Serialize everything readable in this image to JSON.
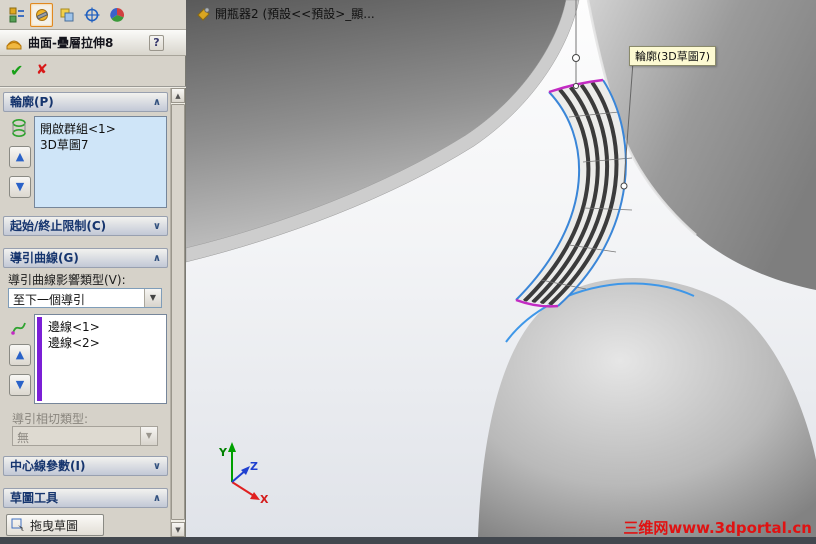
{
  "icons": {
    "help": "?",
    "ok": "✔",
    "cancel": "✘",
    "up_arrow": "▲",
    "down_arrow": "▼",
    "expanded": "∧",
    "collapsed": "∨",
    "combo_arrow": "▼",
    "scroll_up": "▲",
    "scroll_down": "▼"
  },
  "colors": {
    "selection_blue": "#cfe5f8",
    "guide_purple": "#7b1fd6",
    "edge_blue": "#3a86d8",
    "profile_magenta": "#c32bc3",
    "watermark_red": "#e01212"
  },
  "panel": {
    "title": "曲面-疊層拉伸8",
    "sections": {
      "profiles": {
        "header": "輪廓(P)",
        "items": [
          "開啟群組<1>",
          "3D草圖7"
        ]
      },
      "start_end": {
        "header": "起始/終止限制(C)"
      },
      "guides": {
        "header": "導引曲線(G)",
        "influence_label": "導引曲線影響類型(V):",
        "influence_value": "至下一個導引",
        "items": [
          "邊線<1>",
          "邊線<2>"
        ],
        "tangency_label": "導引相切類型:",
        "tangency_value": "無"
      },
      "centerline": {
        "header": "中心線參數(I)"
      },
      "sketch_tools": {
        "header": "草圖工具",
        "drag_button": "拖曳草圖"
      }
    }
  },
  "viewport": {
    "doc_label": "開瓶器2 (預設<<預設>_顯...",
    "callout": "輪廓(3D草圖7)",
    "triad": {
      "x": "X",
      "y": "Y",
      "z": "Z"
    },
    "watermark": "三维网www.3dportal.cn"
  }
}
